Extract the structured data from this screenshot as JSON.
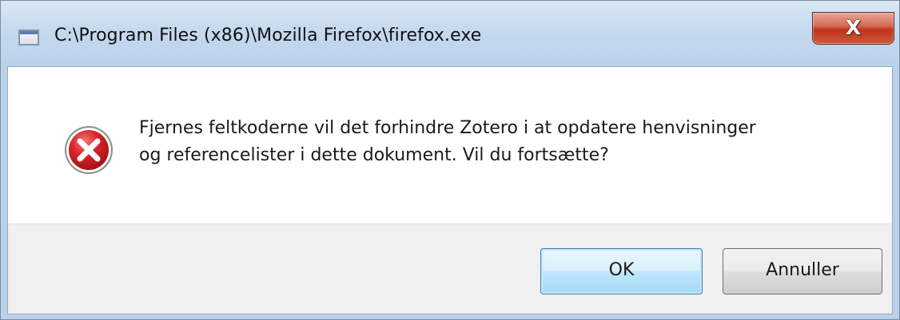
{
  "window": {
    "title": "C:\\Program Files (x86)\\Mozilla Firefox\\firefox.exe",
    "close_glyph": "X"
  },
  "message": {
    "icon": "error-icon",
    "line1": "Fjernes feltkoderne vil det forhindre Zotero i at opdatere henvisninger",
    "line2": "og referencelister i dette dokument. Vil du fortsætte?"
  },
  "buttons": {
    "ok_label": "OK",
    "cancel_label": "Annuller"
  },
  "colors": {
    "titlebar": "#c5d9ee",
    "close_button": "#c0331a",
    "error_icon": "#c4161c",
    "button_bar": "#f0f0f0",
    "default_button_border": "#3c7fb1"
  }
}
